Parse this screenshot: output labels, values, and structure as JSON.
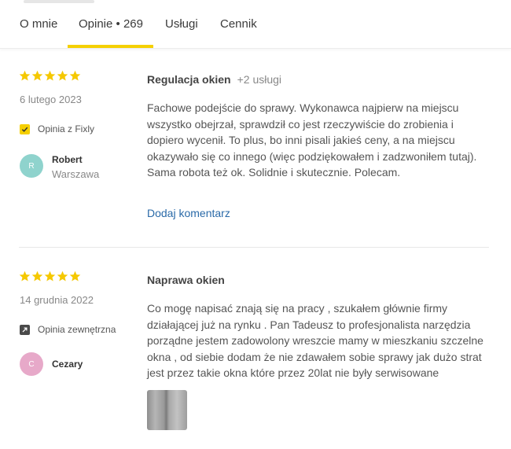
{
  "tabs": [
    {
      "label": "O mnie"
    },
    {
      "label": "Opinie • 269"
    },
    {
      "label": "Usługi"
    },
    {
      "label": "Cennik"
    }
  ],
  "reviews": [
    {
      "rating": 5,
      "date": "6 lutego 2023",
      "source": "Opinia z Fixly",
      "author": {
        "initial": "R",
        "name": "Robert",
        "city": "Warszawa"
      },
      "title": "Regulacja okien",
      "extra": "+2 usługi",
      "body": "Fachowe podejście do sprawy. Wykonawca najpierw na miejscu wszystko obejrzał, sprawdził co jest rzeczywiście do zrobienia i dopiero wycenił. To plus, bo inni pisali jakieś ceny, a na miejscu okazywało się co innego (więc podziękowałem i zadzwoniłem tutaj). Sama robota też ok. Solidnie i skutecznie. Polecam.",
      "comment_link": "Dodaj komentarz"
    },
    {
      "rating": 5,
      "date": "14 grudnia 2022",
      "source": "Opinia zewnętrzna",
      "author": {
        "initial": "C",
        "name": "Cezary"
      },
      "title": "Naprawa okien",
      "body": "Co mogę napisać znają się na pracy , szukałem głównie firmy działającej już na rynku . Pan Tadeusz to profesjonalista narzędzia porządne jestem zadowolony wreszcie mamy w mieszkaniu szczelne okna , od siebie dodam że nie zdawałem sobie sprawy jak dużo strat jest przez takie okna które przez 20lat nie były serwisowane"
    }
  ],
  "colors": {
    "accent": "#f5d000",
    "star": "#f5c800",
    "link": "#2a6aa8",
    "avatar_r": "#8fd3cd",
    "avatar_c": "#e7a9c9"
  },
  "icons": {
    "star": "star-icon",
    "checkbox": "checkbox-checked-icon",
    "external": "external-link-icon"
  }
}
